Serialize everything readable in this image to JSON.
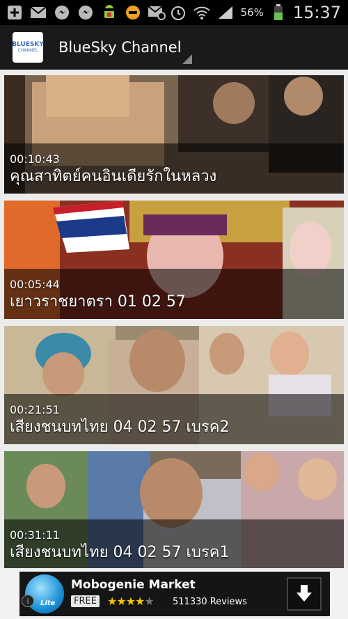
{
  "status_bar": {
    "icons_left": [
      "plus-icon",
      "mail-icon",
      "messenger-icon",
      "messenger-icon",
      "android-debug-icon",
      "minus-circle-icon",
      "email-sync-icon"
    ],
    "icons_right": [
      "alarm-icon",
      "wifi-icon",
      "signal-icon",
      "battery-icon"
    ],
    "battery_pct": "56%",
    "time": "15:37"
  },
  "action_bar": {
    "logo_line1": "BLUESKY",
    "logo_line2": "CHANNEL",
    "title": "BlueSky Channel"
  },
  "videos": [
    {
      "duration": "00:10:43",
      "title": "คุณสาทิตย์คนอินเดียรักในหลวง"
    },
    {
      "duration": "00:05:44",
      "title": "เยาวราชยาตรา 01 02 57"
    },
    {
      "duration": "00:21:51",
      "title": "เสียงชนบทไทย 04 02 57 เบรค2"
    },
    {
      "duration": "00:31:11",
      "title": "เสียงชนบทไทย 04 02 57 เบรค1"
    }
  ],
  "ad": {
    "icon_badge": "Lite",
    "name": "Mobogenie Market",
    "free_label": "FREE",
    "stars": "★★★★",
    "stars_empty": "★",
    "reviews": "511330 Reviews",
    "info": "i"
  }
}
